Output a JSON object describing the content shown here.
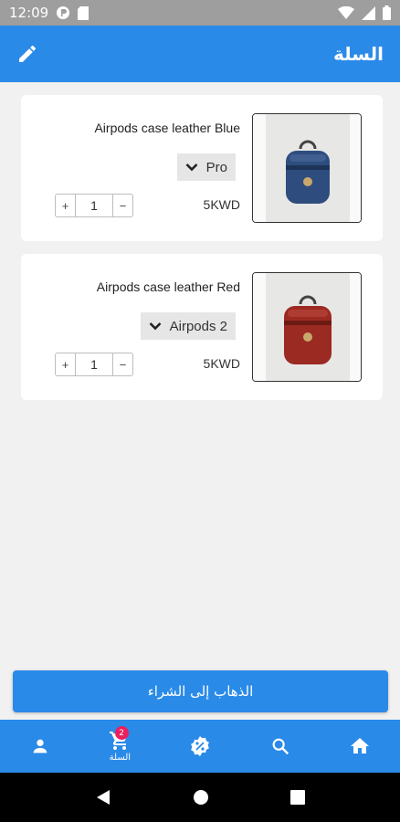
{
  "status_bar": {
    "time": "12:09"
  },
  "app_bar": {
    "title": "السلة",
    "edit_icon": "pencil-icon"
  },
  "cart": {
    "items": [
      {
        "name": "Airpods case leather Blue",
        "variant": "Pro",
        "price": "5KWD",
        "quantity": "1",
        "case_color": "#2e4d7e"
      },
      {
        "name": "Airpods case leather Red",
        "variant": "Airpods 2",
        "price": "5KWD",
        "quantity": "1",
        "case_color": "#9b2a22"
      }
    ],
    "stepper": {
      "plus": "+",
      "minus": "−"
    }
  },
  "checkout": {
    "label": "الذهاب إلى الشراء"
  },
  "bottom_nav": {
    "items": [
      {
        "icon": "person-icon"
      },
      {
        "icon": "cart-icon",
        "label": "السلة",
        "badge": "2"
      },
      {
        "icon": "discount-icon"
      },
      {
        "icon": "search-icon"
      },
      {
        "icon": "home-icon"
      }
    ]
  },
  "colors": {
    "primary": "#2a8ae8",
    "badge": "#e8205c",
    "background": "#f1f1f1"
  }
}
